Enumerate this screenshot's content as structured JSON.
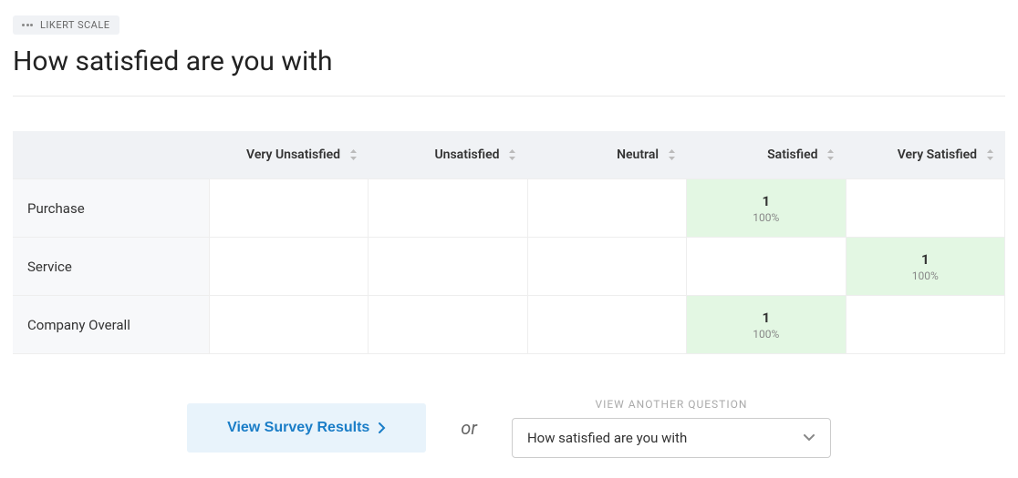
{
  "question_type": "LIKERT SCALE",
  "title": "How satisfied are you with",
  "columns": [
    "Very Unsatisfied",
    "Unsatisfied",
    "Neutral",
    "Satisfied",
    "Very Satisfied"
  ],
  "rows": [
    {
      "label": "Purchase",
      "cells": [
        {
          "count": null,
          "percent": null
        },
        {
          "count": null,
          "percent": null
        },
        {
          "count": null,
          "percent": null
        },
        {
          "count": "1",
          "percent": "100%"
        },
        {
          "count": null,
          "percent": null
        }
      ]
    },
    {
      "label": "Service",
      "cells": [
        {
          "count": null,
          "percent": null
        },
        {
          "count": null,
          "percent": null
        },
        {
          "count": null,
          "percent": null
        },
        {
          "count": null,
          "percent": null
        },
        {
          "count": "1",
          "percent": "100%"
        }
      ]
    },
    {
      "label": "Company Overall",
      "cells": [
        {
          "count": null,
          "percent": null
        },
        {
          "count": null,
          "percent": null
        },
        {
          "count": null,
          "percent": null
        },
        {
          "count": "1",
          "percent": "100%"
        },
        {
          "count": null,
          "percent": null
        }
      ]
    }
  ],
  "footer": {
    "view_results_label": "View Survey Results",
    "or_text": "or",
    "dropdown_label": "VIEW ANOTHER QUESTION",
    "dropdown_selected": "How satisfied are you with"
  }
}
